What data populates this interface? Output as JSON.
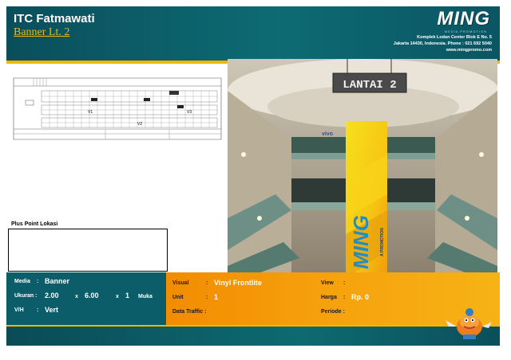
{
  "header": {
    "title": "ITC Fatmawati",
    "subtitle": "Banner Lt. 2",
    "logo": "MING",
    "logo_tagline": "MEDIA PROMOTION",
    "address_line1": "Komplek Lodan Center Blok E No. 5",
    "address_line2": "Jakarta 14430, Indonesia. Phone : 021 692 5040",
    "address_line3": "www.mingpromo.com"
  },
  "floorplan": {
    "zone_labels": [
      "V1",
      "V2",
      "V3"
    ]
  },
  "photo": {
    "sign_text": "LANTAI 2",
    "banner_text": "MING",
    "banner_subtext": "A PROMOTION",
    "store_sign": "vivo"
  },
  "plus_point": {
    "label": "Plus Point Lokasi",
    "content": ""
  },
  "info": {
    "media_label": "Media",
    "media_value": "Banner",
    "ukuran_label": "Ukuran :",
    "ukuran_w": "2.00",
    "times1": "x",
    "ukuran_h": "6.00",
    "times2": "x",
    "ukuran_qty": "1",
    "muka_label": "Muka",
    "vh_label": "V/H",
    "vh_value": "Vert",
    "visual_label": "Visual",
    "visual_value": "Vinyl Frontlite",
    "unit_label": "Unit",
    "unit_value": "1",
    "traffic_label": "Data Traffic :",
    "view_label": "View",
    "harga_label": "Harga",
    "harga_value": "Rp. 0",
    "periode_label": "Periode :"
  },
  "colors": {
    "teal": "#0b5d69",
    "orange": "#f28c00",
    "yellow": "#f2b705"
  }
}
